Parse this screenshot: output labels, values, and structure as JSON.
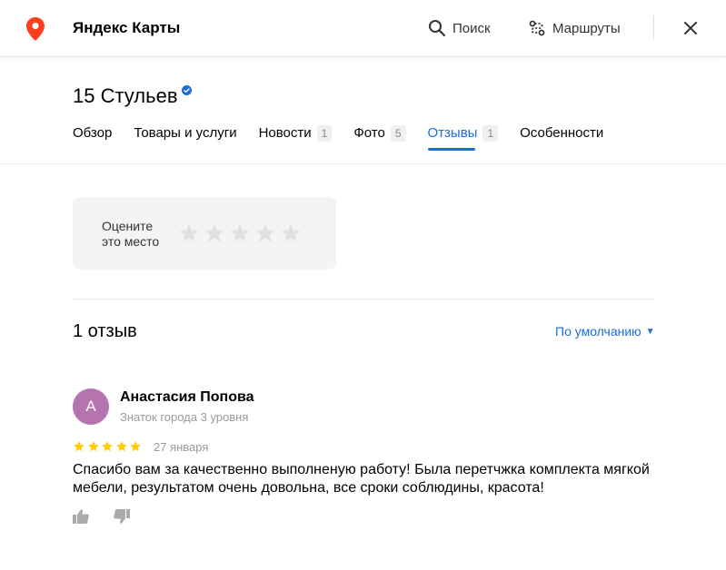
{
  "header": {
    "app_title": "Яндекс Карты",
    "search_label": "Поиск",
    "routes_label": "Маршруты",
    "logo_icon": "map-pin-icon",
    "accent_color": "#fc3f1d"
  },
  "org": {
    "name": "15 Стульев",
    "verified": true
  },
  "tabs": [
    {
      "label": "Обзор",
      "count": ""
    },
    {
      "label": "Товары и услуги",
      "count": ""
    },
    {
      "label": "Новости",
      "count": "1"
    },
    {
      "label": "Фото",
      "count": "5"
    },
    {
      "label": "Отзывы",
      "count": "1",
      "active": true
    },
    {
      "label": "Особенности",
      "count": ""
    }
  ],
  "rating_prompt": {
    "label_line1": "Оцените",
    "label_line2": "это место",
    "stars_total": 5
  },
  "reviews": {
    "count_label": "1 отзыв",
    "sort_label": "По умолчанию",
    "items": [
      {
        "avatar_letter": "А",
        "avatar_color": "#b573b0",
        "author": "Анастасия Попова",
        "level": "Знаток города 3 уровня",
        "stars": 5,
        "date": "27 января",
        "text": "Спасибо вам за качественно выполненую работу! Была перетчжка комплекта мягкой мебели, результатом очень довольна, все сроки соблюдины, красота!"
      }
    ]
  },
  "colors": {
    "link_blue": "#1a6dd8",
    "star_gold": "#fc0",
    "star_empty": "#e0e0e0"
  }
}
